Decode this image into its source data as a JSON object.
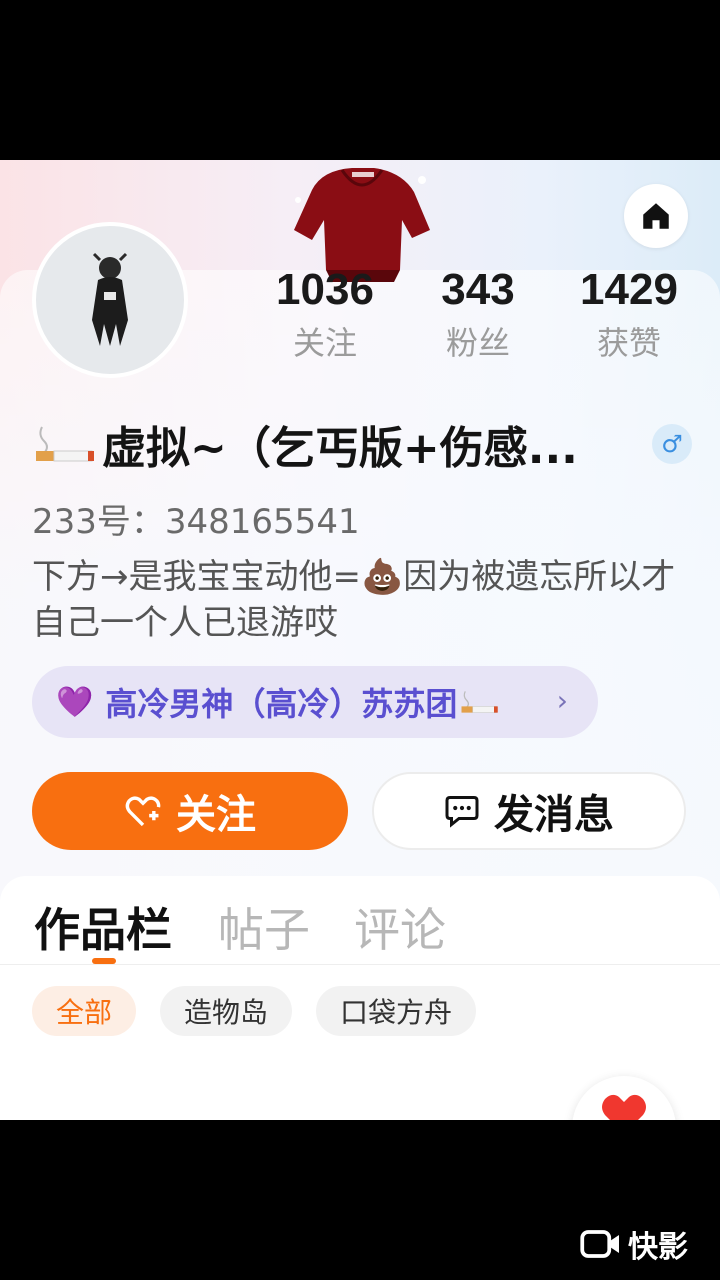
{
  "header": {
    "home_icon": "home-icon"
  },
  "profile": {
    "stats": [
      {
        "value": "1036",
        "label": "关注"
      },
      {
        "value": "343",
        "label": "粉丝"
      },
      {
        "value": "1429",
        "label": "获赞"
      }
    ],
    "name": "虚拟~（乞丐版+伤感...",
    "gender_symbol": "♂",
    "id_line": "233号：348165541",
    "bio": "下方→是我宝宝动他=💩因为被遗忘所以才自己一个人已退游哎",
    "group": {
      "label": "高冷男神（高冷）苏苏团",
      "chevron": "›"
    }
  },
  "actions": {
    "follow_label": "关注",
    "message_label": "发消息"
  },
  "tabs": [
    {
      "label": "作品栏",
      "active": true
    },
    {
      "label": "帖子",
      "active": false
    },
    {
      "label": "评论",
      "active": false
    }
  ],
  "filters": [
    {
      "label": "全部",
      "active": true
    },
    {
      "label": "造物岛",
      "active": false
    },
    {
      "label": "口袋方舟",
      "active": false
    }
  ],
  "watermark": {
    "label": "快影"
  },
  "colors": {
    "accent": "#f86f10",
    "group_text": "#5a4fd0",
    "gender": "#3a8fe0"
  }
}
